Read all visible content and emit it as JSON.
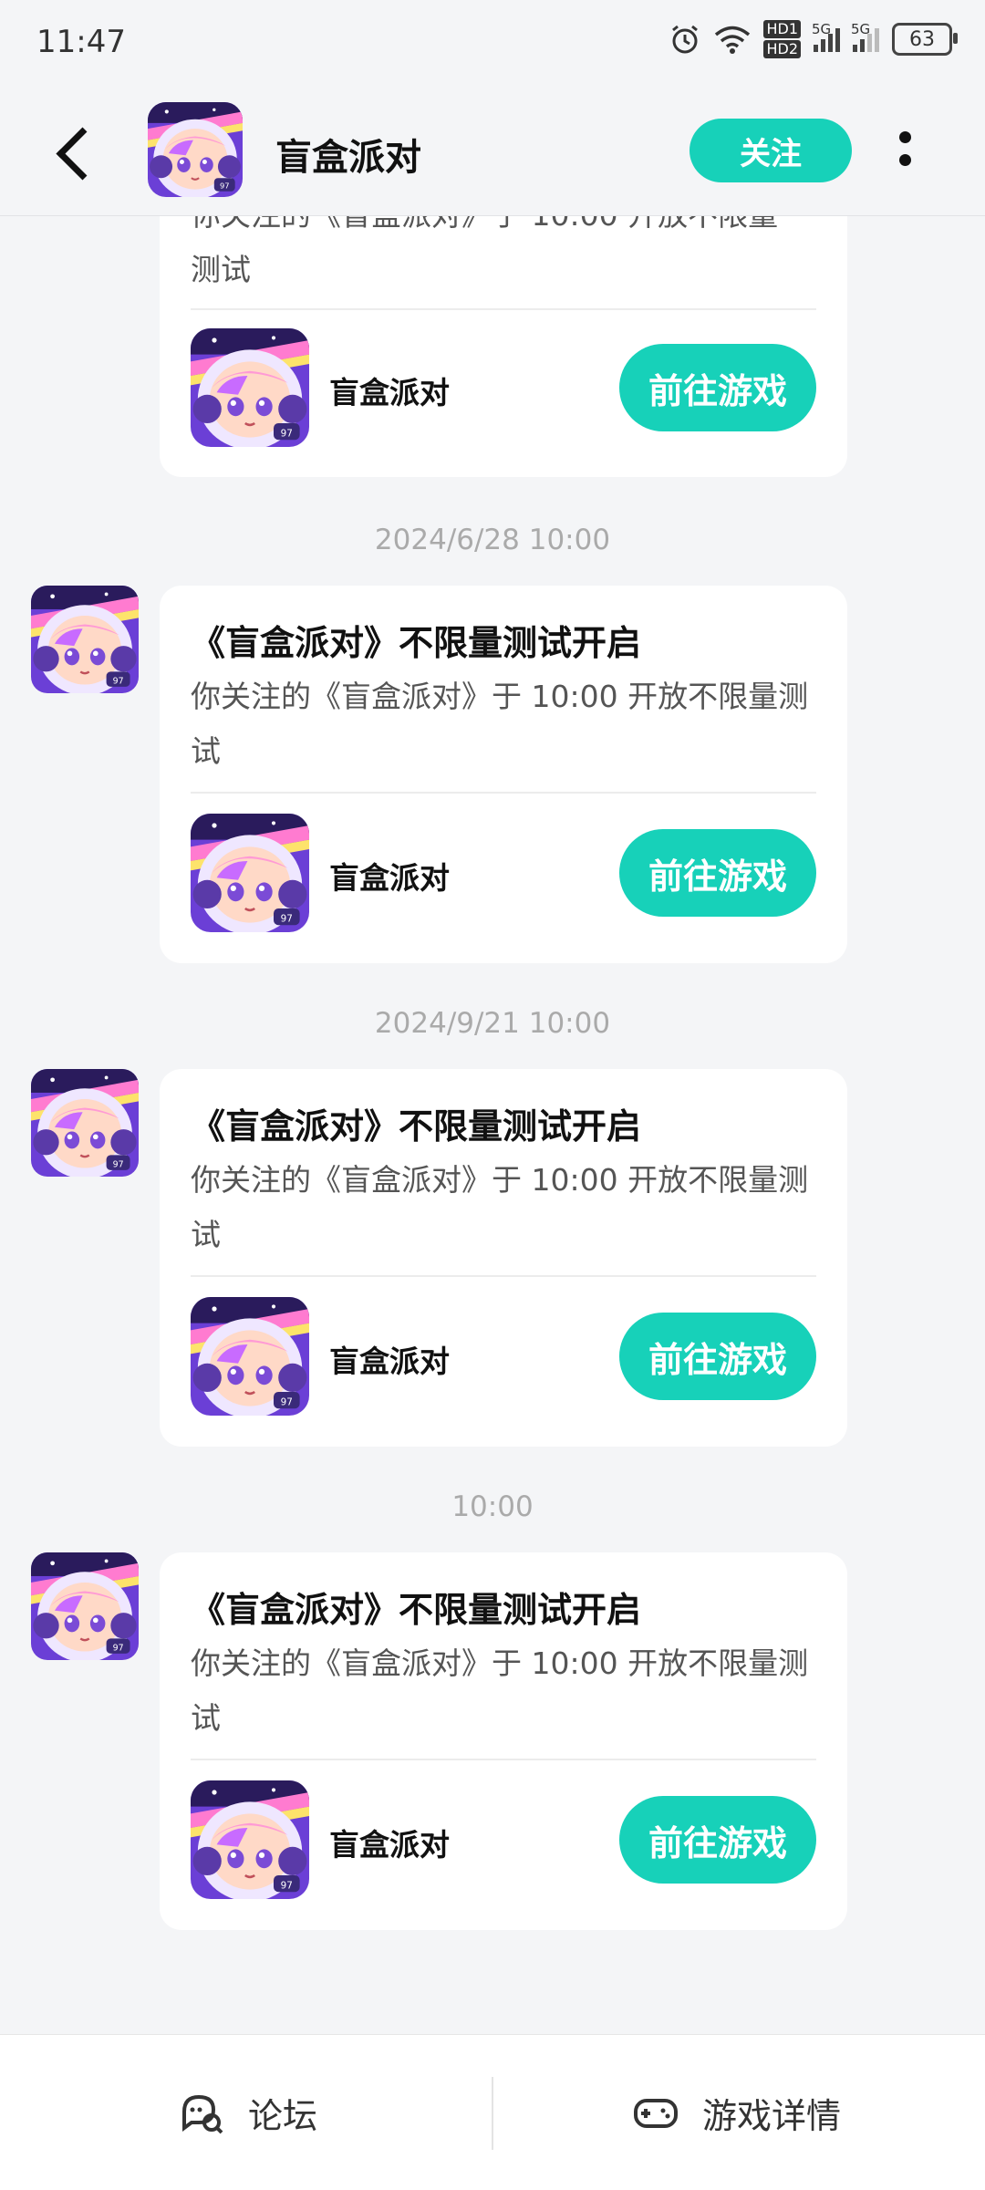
{
  "status_bar": {
    "time": "11:47",
    "hd1": "HD1",
    "hd2": "HD2",
    "net1": "5G",
    "net2": "5G",
    "battery": "63"
  },
  "header": {
    "title": "盲盒派对",
    "follow_label": "关注"
  },
  "messages": [
    {
      "timestamp": "",
      "title": "",
      "body_partial": "你关注的《盲盒派对》于 10:00 开放不限量",
      "body_line2": "测试",
      "game_name": "盲盒派对",
      "button": "前往游戏"
    },
    {
      "timestamp": "2024/6/28  10:00",
      "title": "《盲盒派对》不限量测试开启",
      "body": "你关注的《盲盒派对》于 10:00 开放不限量测试",
      "game_name": "盲盒派对",
      "button": "前往游戏"
    },
    {
      "timestamp": "2024/9/21  10:00",
      "title": "《盲盒派对》不限量测试开启",
      "body": "你关注的《盲盒派对》于 10:00 开放不限量测试",
      "game_name": "盲盒派对",
      "button": "前往游戏"
    },
    {
      "timestamp": "10:00",
      "title": "《盲盒派对》不限量测试开启",
      "body": "你关注的《盲盒派对》于 10:00 开放不限量测试",
      "game_name": "盲盒派对",
      "button": "前往游戏"
    }
  ],
  "bottom_bar": {
    "forum_label": "论坛",
    "details_label": "游戏详情"
  },
  "colors": {
    "accent": "#17d1b9",
    "background": "#f4f5f7"
  }
}
